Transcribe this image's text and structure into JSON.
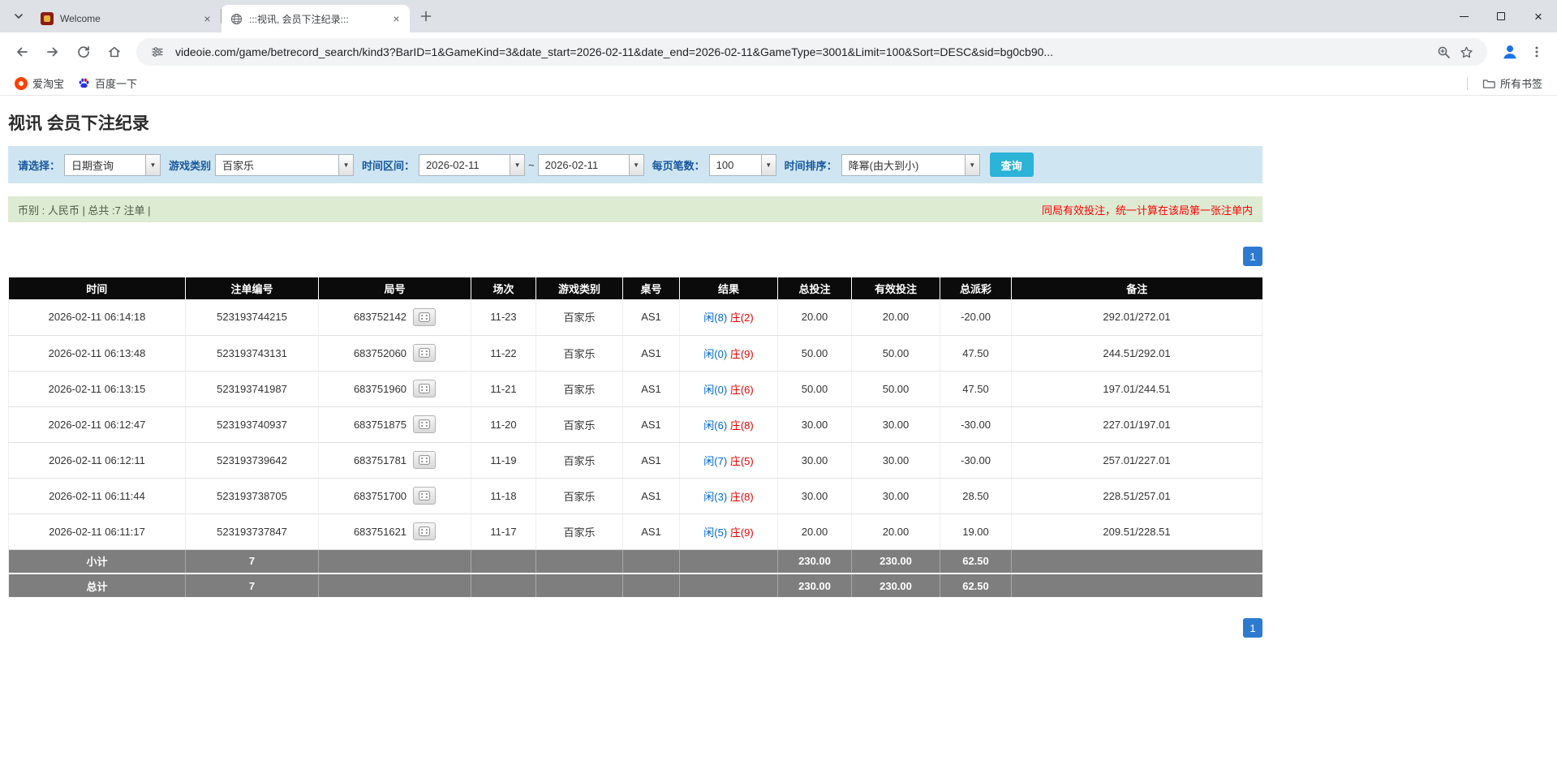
{
  "browser": {
    "tab_search": "tab list",
    "tabs": [
      {
        "title": "Welcome"
      },
      {
        "title": ":::视讯, 会员下注纪录:::"
      }
    ],
    "url": "videoie.com/game/betrecord_search/kind3?BarID=1&GameKind=3&date_start=2026-02-11&date_end=2026-02-11&GameType=3001&Limit=100&Sort=DESC&sid=bg0cb90...",
    "bookmarks": [
      {
        "label": "爱淘宝"
      },
      {
        "label": "百度一下"
      }
    ],
    "all_bookmarks": "所有书签"
  },
  "page": {
    "title": "视讯 会员下注纪录"
  },
  "filters": {
    "select_label": "请选择：",
    "select_value": "日期查询",
    "game_label": "游戏类别",
    "game_value": "百家乐",
    "range_label": "时间区间：",
    "date_start": "2026-02-11",
    "range_sep": "~",
    "date_end": "2026-02-11",
    "per_page_label": "每页笔数：",
    "per_page_value": "100",
    "sort_label": "时间排序：",
    "sort_value": "降幂(由大到小)",
    "search_button": "查询"
  },
  "info": {
    "summary": "币别 : 人民币 | 总共 :7 注单 |",
    "notice": "同局有效投注，统一计算在该局第一张注单内"
  },
  "pagination": {
    "page": "1"
  },
  "table": {
    "headers": [
      "时间",
      "注单编号",
      "局号",
      "场次",
      "游戏类别",
      "桌号",
      "结果",
      "总投注",
      "有效投注",
      "总派彩",
      "备注"
    ],
    "rows": [
      {
        "time": "2026-02-11 06:14:18",
        "bet_id": "523193744215",
        "round": "683752142",
        "session": "11-23",
        "game": "百家乐",
        "table": "AS1",
        "player": "闲(8)",
        "banker": "庄(2)",
        "total_bet": "20.00",
        "valid_bet": "20.00",
        "payout": "-20.00",
        "note": "292.01/272.01"
      },
      {
        "time": "2026-02-11 06:13:48",
        "bet_id": "523193743131",
        "round": "683752060",
        "session": "11-22",
        "game": "百家乐",
        "table": "AS1",
        "player": "闲(0)",
        "banker": "庄(9)",
        "total_bet": "50.00",
        "valid_bet": "50.00",
        "payout": "47.50",
        "note": "244.51/292.01"
      },
      {
        "time": "2026-02-11 06:13:15",
        "bet_id": "523193741987",
        "round": "683751960",
        "session": "11-21",
        "game": "百家乐",
        "table": "AS1",
        "player": "闲(0)",
        "banker": "庄(6)",
        "total_bet": "50.00",
        "valid_bet": "50.00",
        "payout": "47.50",
        "note": "197.01/244.51"
      },
      {
        "time": "2026-02-11 06:12:47",
        "bet_id": "523193740937",
        "round": "683751875",
        "session": "11-20",
        "game": "百家乐",
        "table": "AS1",
        "player": "闲(6)",
        "banker": "庄(8)",
        "total_bet": "30.00",
        "valid_bet": "30.00",
        "payout": "-30.00",
        "note": "227.01/197.01"
      },
      {
        "time": "2026-02-11 06:12:11",
        "bet_id": "523193739642",
        "round": "683751781",
        "session": "11-19",
        "game": "百家乐",
        "table": "AS1",
        "player": "闲(7)",
        "banker": "庄(5)",
        "total_bet": "30.00",
        "valid_bet": "30.00",
        "payout": "-30.00",
        "note": "257.01/227.01"
      },
      {
        "time": "2026-02-11 06:11:44",
        "bet_id": "523193738705",
        "round": "683751700",
        "session": "11-18",
        "game": "百家乐",
        "table": "AS1",
        "player": "闲(3)",
        "banker": "庄(8)",
        "total_bet": "30.00",
        "valid_bet": "30.00",
        "payout": "28.50",
        "note": "228.51/257.01"
      },
      {
        "time": "2026-02-11 06:11:17",
        "bet_id": "523193737847",
        "round": "683751621",
        "session": "11-17",
        "game": "百家乐",
        "table": "AS1",
        "player": "闲(5)",
        "banker": "庄(9)",
        "total_bet": "20.00",
        "valid_bet": "20.00",
        "payout": "19.00",
        "note": "209.51/228.51"
      }
    ],
    "subtotal": {
      "label": "小计",
      "count": "7",
      "total_bet": "230.00",
      "valid_bet": "230.00",
      "payout": "62.50"
    },
    "total": {
      "label": "总计",
      "count": "7",
      "total_bet": "230.00",
      "valid_bet": "230.00",
      "payout": "62.50"
    }
  },
  "colors": {
    "accent_blue": "#0066cc",
    "negative_red": "#e60000",
    "notice_red": "#ff0000",
    "search_button": "#2bb3d8",
    "pagination_blue": "#2e7ad1"
  }
}
